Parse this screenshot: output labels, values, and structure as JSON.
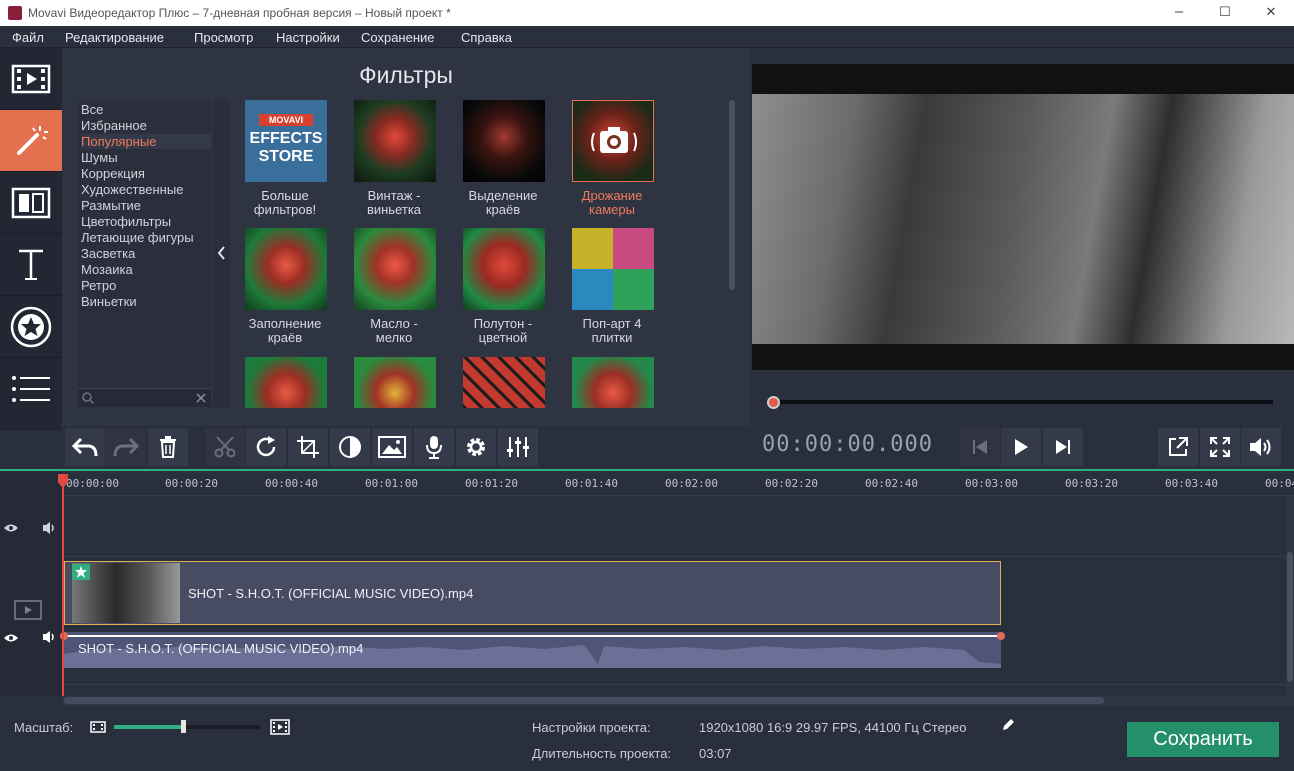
{
  "window": {
    "title": "Movavi Видеоредактор Плюс – 7-дневная пробная версия – Новый проект *",
    "minimize": "–",
    "maximize": "☐",
    "close": "✕"
  },
  "menu": [
    "Файл",
    "Редактирование",
    "Просмотр",
    "Настройки",
    "Сохранение",
    "Справка"
  ],
  "left_tools": [
    "film-icon",
    "magic-wand-icon",
    "transitions-icon",
    "text-icon",
    "star-sticker-icon",
    "list-icon"
  ],
  "filters": {
    "heading": "Фильтры",
    "categories": [
      "Все",
      "Избранное",
      "Популярные",
      "Шумы",
      "Коррекция",
      "Художественные",
      "Размытие",
      "Цветофильтры",
      "Летающие фигуры",
      "Засветка",
      "Мозаика",
      "Ретро",
      "Виньетки"
    ],
    "selected_category": "Популярные",
    "store_tile": {
      "brand": "MOVAVI",
      "line1": "EFFECTS",
      "line2": "STORE"
    },
    "tiles": [
      {
        "line1": "Больше",
        "line2": "фильтров!"
      },
      {
        "line1": "Винтаж -",
        "line2": "виньетка"
      },
      {
        "line1": "Выделение",
        "line2": "краёв"
      },
      {
        "line1": "Дрожание",
        "line2": "камеры"
      },
      {
        "line1": "Заполнение",
        "line2": "краёв"
      },
      {
        "line1": "Масло -",
        "line2": "мелко"
      },
      {
        "line1": "Полутон -",
        "line2": "цветной"
      },
      {
        "line1": "Поп-арт 4",
        "line2": "плитки"
      }
    ]
  },
  "preview": {
    "timecode": "00:00:00.000",
    "progress": 0.0
  },
  "timeline": {
    "ticks": [
      "00:00:00",
      "00:00:20",
      "00:00:40",
      "00:01:00",
      "00:01:20",
      "00:01:40",
      "00:02:00",
      "00:02:20",
      "00:02:40",
      "00:03:00",
      "00:03:20",
      "00:03:40",
      "00:04"
    ],
    "video_clip": "SHOT - S.H.O.T. (OFFICIAL MUSIC VIDEO).mp4",
    "audio_clip": "SHOT - S.H.O.T. (OFFICIAL MUSIC VIDEO).mp4"
  },
  "bottom": {
    "zoom_label": "Масштаб:",
    "zoom_level": 0.48,
    "settings_label": "Настройки проекта:",
    "settings_value": "1920x1080 16:9 29.97 FPS, 44100 Гц Стерео",
    "duration_label": "Длительность проекта:",
    "duration_value": "03:07",
    "save_label": "Сохранить"
  },
  "colors": {
    "accent": "#e5704f",
    "green": "#2fae80",
    "save": "#23906a"
  }
}
